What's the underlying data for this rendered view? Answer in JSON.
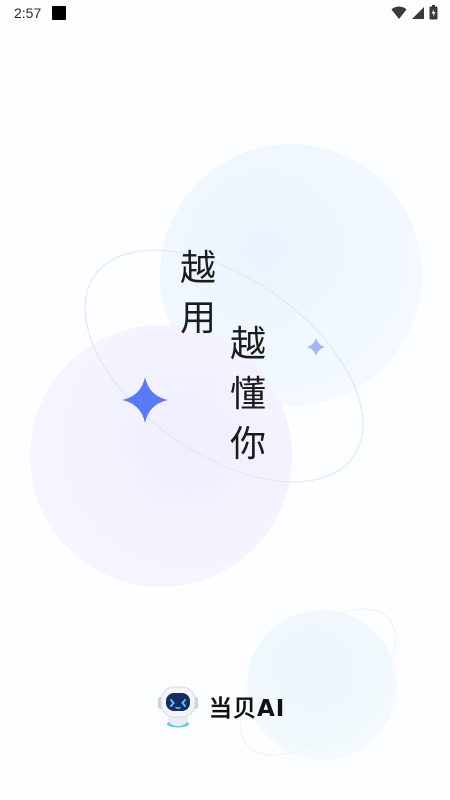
{
  "status_bar": {
    "time": "2:57",
    "icons": [
      "notification-square-icon",
      "wifi-icon",
      "signal-icon",
      "battery-icon"
    ]
  },
  "slogan": {
    "column1": [
      "越",
      "用"
    ],
    "column2": [
      "越",
      "懂",
      "你"
    ]
  },
  "brand": {
    "name": "当贝AI",
    "logo": "robot-mascot-icon"
  },
  "colors": {
    "sparkle_accent": "#5b78f5",
    "text": "#1c1c1c",
    "background": "#fdfeff"
  }
}
